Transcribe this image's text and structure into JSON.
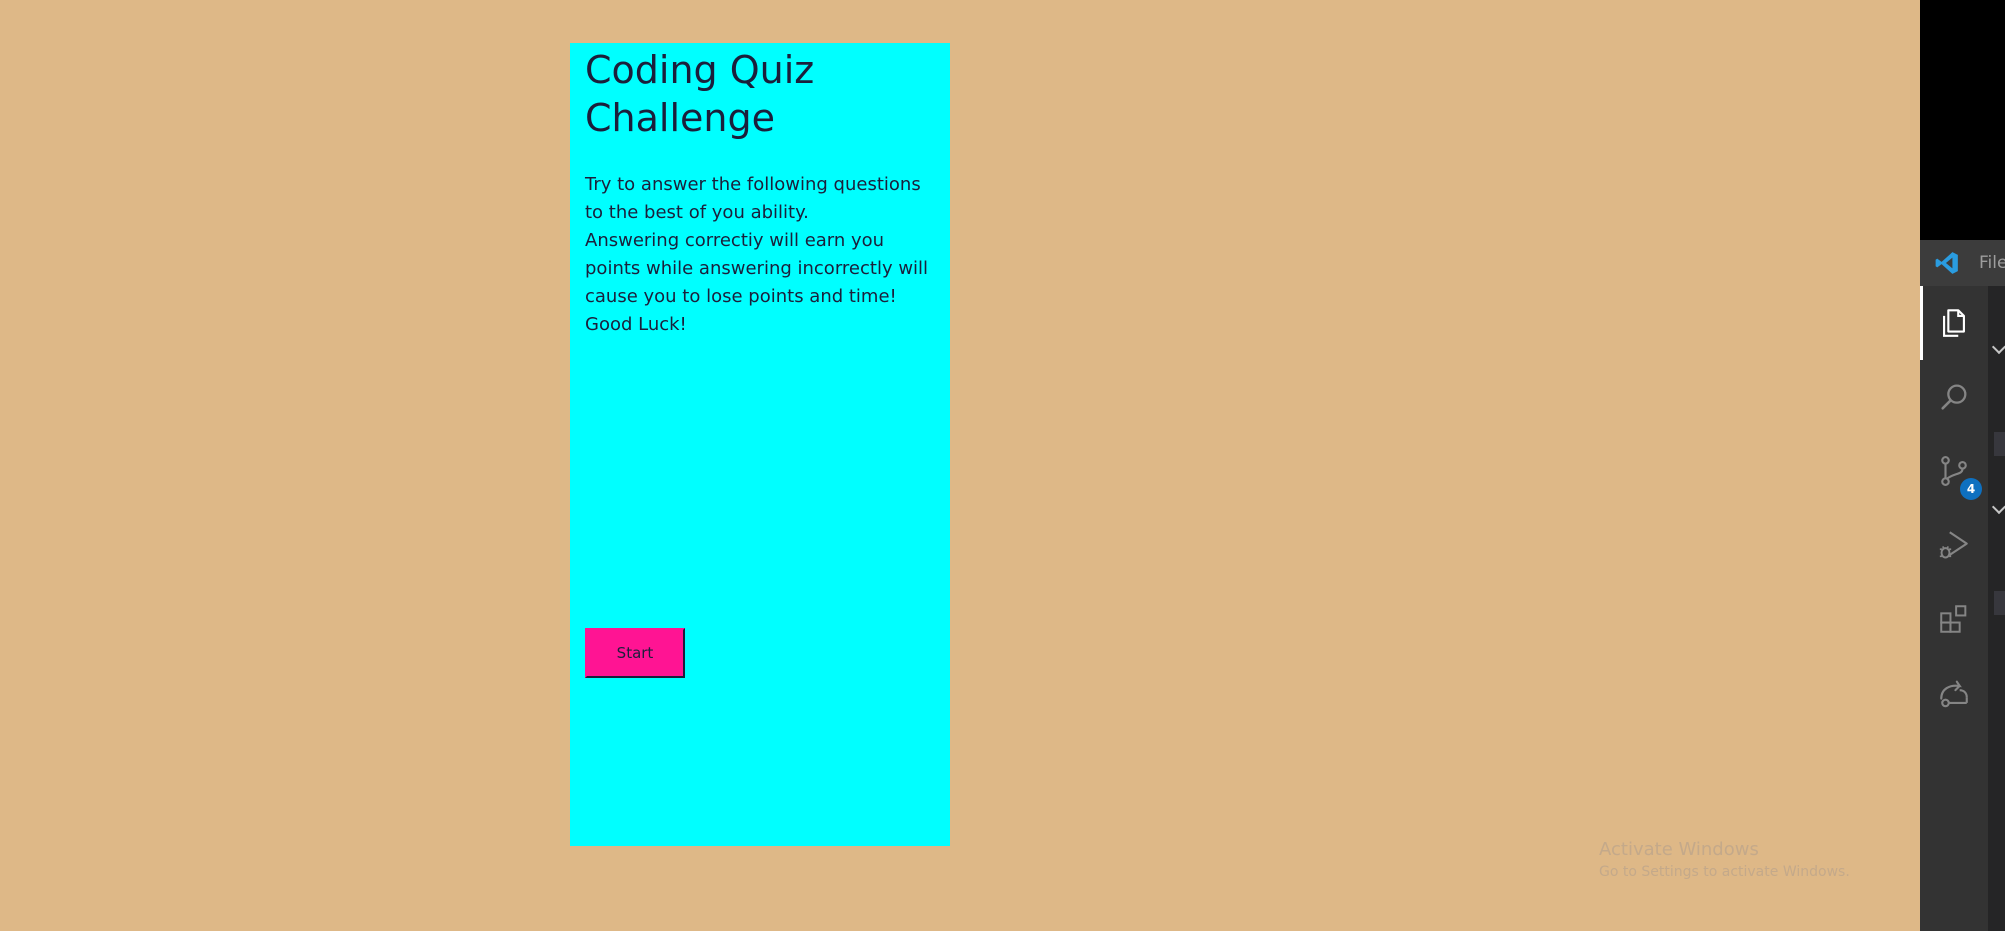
{
  "quiz": {
    "title": "Coding Quiz Challenge",
    "intro_lines": [
      "Try to answer the following questions to the best of you ability.",
      "Answering correctiy will earn you points while answering incorrectly will cause you to lose points and time!",
      "Good Luck!"
    ],
    "start_label": "Start"
  },
  "watermark": {
    "title": "Activate Windows",
    "subtitle": "Go to Settings to activate Windows."
  },
  "vscode": {
    "menu_file": "File",
    "activity_items": [
      {
        "icon": "explorer-icon",
        "active": true
      },
      {
        "icon": "search-icon",
        "active": false
      },
      {
        "icon": "source-control-icon",
        "active": false,
        "badge": "4"
      },
      {
        "icon": "run-debug-icon",
        "active": false
      },
      {
        "icon": "extensions-icon",
        "active": false
      },
      {
        "icon": "remote-explorer-icon",
        "active": false
      }
    ]
  },
  "colors": {
    "page_background": "#deb887",
    "card_background": "#00ffff",
    "button_background": "#ff1493",
    "text": "#1b1f3b",
    "vscode_badge": "#0e70c0"
  }
}
